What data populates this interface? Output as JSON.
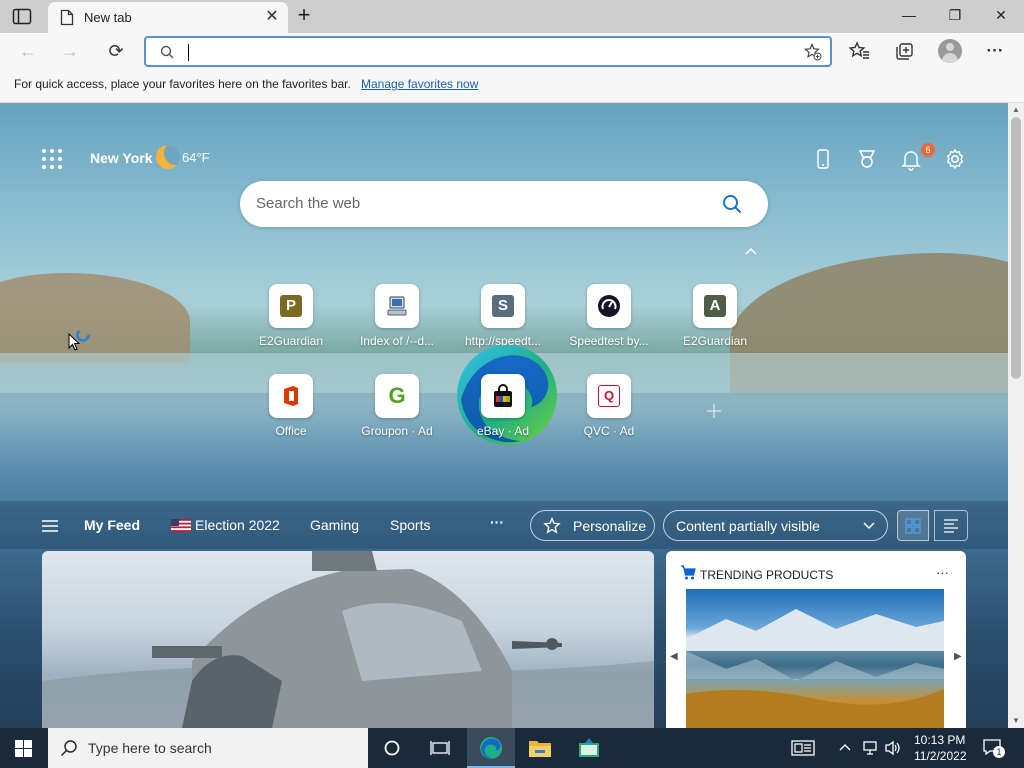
{
  "tab": {
    "title": "New tab",
    "close": "✕"
  },
  "new_tab": "+",
  "window_controls": {
    "minimize": "—",
    "maximize": "❐",
    "close": "✕"
  },
  "toolbar": {
    "back": "←",
    "forward": "→",
    "refresh": "⟳",
    "address_value": "",
    "more": "···"
  },
  "favorites_bar": {
    "message": "For quick access, place your favorites here on the favorites bar.",
    "link": "Manage favorites now"
  },
  "weather": {
    "city": "New York",
    "temperature": "64°F"
  },
  "notifications_count": "6",
  "web_search": {
    "placeholder": "Search the web"
  },
  "quick_links": [
    {
      "label": "E2Guardian",
      "icon": "P",
      "color": "#7a6a22"
    },
    {
      "label": "Index of /--d...",
      "icon": "computer",
      "color": "#6b7b8c"
    },
    {
      "label": "http://speedt...",
      "icon": "S",
      "color": "#586d7e"
    },
    {
      "label": "Speedtest by...",
      "icon": "speedometer",
      "color": "#141526"
    },
    {
      "label": "E2Guardian",
      "icon": "A",
      "color": "#4d5d48"
    },
    {
      "label": "Office",
      "icon": "office",
      "color": "#d83b01"
    },
    {
      "label": "Groupon · Ad",
      "icon": "G",
      "color": "#53a318"
    },
    {
      "label": "eBay · Ad",
      "icon": "bag",
      "color": "#111111"
    },
    {
      "label": "QVC · Ad",
      "icon": "Q",
      "color": "#c8102e"
    }
  ],
  "feed": {
    "my_feed": "My Feed",
    "tabs": [
      "Election 2022",
      "Gaming",
      "Sports"
    ],
    "more": "···",
    "personalize": "Personalize",
    "content_visibility": "Content partially visible"
  },
  "trending": {
    "title": "TRENDING PRODUCTS",
    "more": "···"
  },
  "taskbar": {
    "search_placeholder": "Type here to search",
    "time": "10:13 PM",
    "date": "11/2/2022",
    "notification_count": "1"
  }
}
